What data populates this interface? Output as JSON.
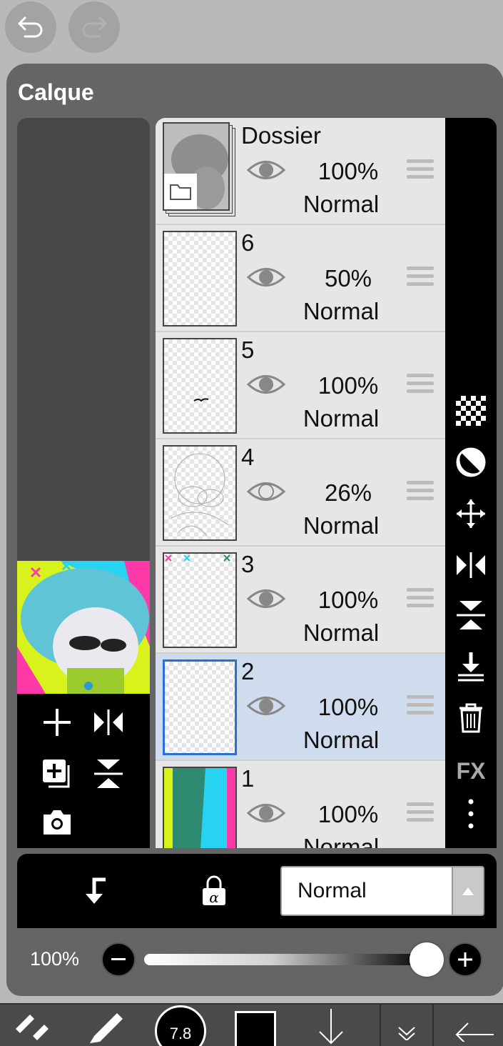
{
  "top": {
    "undo_icon": "undo-icon",
    "redo_icon": "redo-icon"
  },
  "panel": {
    "title": "Calque"
  },
  "layers": [
    {
      "name": "Dossier",
      "opacity": "100%",
      "mode": "Normal",
      "visible": true,
      "type": "folder"
    },
    {
      "name": "6",
      "opacity": "50%",
      "mode": "Normal",
      "visible": true
    },
    {
      "name": "5",
      "opacity": "100%",
      "mode": "Normal",
      "visible": true
    },
    {
      "name": "4",
      "opacity": "26%",
      "mode": "Normal",
      "visible": false
    },
    {
      "name": "3",
      "opacity": "100%",
      "mode": "Normal",
      "visible": true
    },
    {
      "name": "2",
      "opacity": "100%",
      "mode": "Normal",
      "visible": true,
      "selected": true
    },
    {
      "name": "1",
      "opacity": "100%",
      "mode": "Normal",
      "visible": true
    }
  ],
  "blend": {
    "value": "Normal"
  },
  "opacity_slider": {
    "label": "100%",
    "value": 1.0
  },
  "toolbar": {
    "brush_size": "7.8"
  },
  "colors": {
    "selected_layer": "#cfdcee",
    "selection_border": "#2b6fd6",
    "panel": "#656565"
  }
}
